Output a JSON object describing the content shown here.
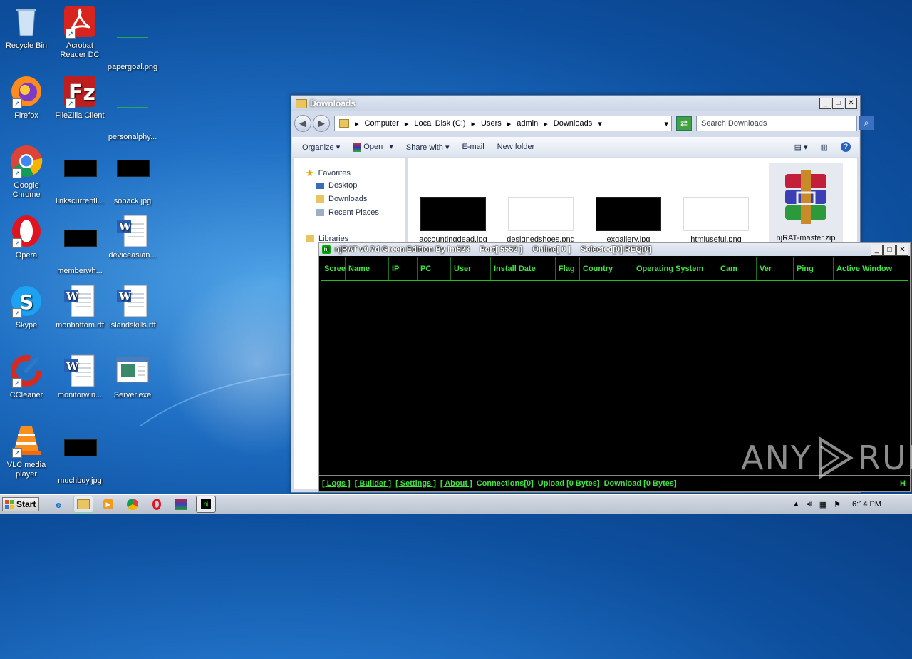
{
  "desktop": {
    "icons": [
      {
        "label": "Recycle Bin"
      },
      {
        "label": "Acrobat Reader DC"
      },
      {
        "label": "papergoal.png"
      },
      {
        "label": "Firefox"
      },
      {
        "label": "FileZilla Client"
      },
      {
        "label": "personalphy..."
      },
      {
        "label": "Google Chrome"
      },
      {
        "label": "linkscurrentl..."
      },
      {
        "label": "soback.jpg"
      },
      {
        "label": "Opera"
      },
      {
        "label": "memberwh..."
      },
      {
        "label": "deviceasian..."
      },
      {
        "label": "Skype"
      },
      {
        "label": "monbottom.rtf"
      },
      {
        "label": "islandskills.rtf"
      },
      {
        "label": "CCleaner"
      },
      {
        "label": "monitorwin..."
      },
      {
        "label": "Server.exe"
      },
      {
        "label": "VLC media player"
      },
      {
        "label": "muchbuy.jpg"
      }
    ]
  },
  "explorer": {
    "title": "Downloads",
    "breadcrumbs": [
      "Computer",
      "Local Disk (C:)",
      "Users",
      "admin",
      "Downloads"
    ],
    "search_placeholder": "Search Downloads",
    "toolbar": {
      "organize": "Organize",
      "open": "Open",
      "share_with": "Share with",
      "email": "E-mail",
      "new_folder": "New folder"
    },
    "sidebar": {
      "favorites": "Favorites",
      "items": [
        "Desktop",
        "Downloads",
        "Recent Places"
      ],
      "libraries": "Libraries"
    },
    "files": [
      {
        "name": "accountingdead.jpg"
      },
      {
        "name": "designedshoes.png"
      },
      {
        "name": "exgallery.jpg"
      },
      {
        "name": "htmluseful.png"
      },
      {
        "name": "njRAT-master.zip"
      }
    ]
  },
  "njrat": {
    "title": "njRAT v0.7d Green Edition By im523",
    "port": "Port[ 5552 ]",
    "online": "Online[ 0 ]",
    "selected": "Selected[0] REQ[0]",
    "columns": [
      "Scree",
      "Name",
      "IP",
      "PC",
      "User",
      "Install Date",
      "Flag",
      "Country",
      "Operating System",
      "Cam",
      "Ver",
      "Ping",
      "Active Window"
    ],
    "status": {
      "logs": "[ Logs ]",
      "builder": "[ Builder ]",
      "settings": "[ Settings ]",
      "about": "[ About ]",
      "connections": "Connections[0]",
      "upload": "Upload [0 Bytes]",
      "download": "Download [0 Bytes]",
      "right": "H"
    }
  },
  "watermark": {
    "left": "ANY",
    "right": "RUN"
  },
  "taskbar": {
    "start": "Start",
    "clock": "6:14 PM"
  }
}
